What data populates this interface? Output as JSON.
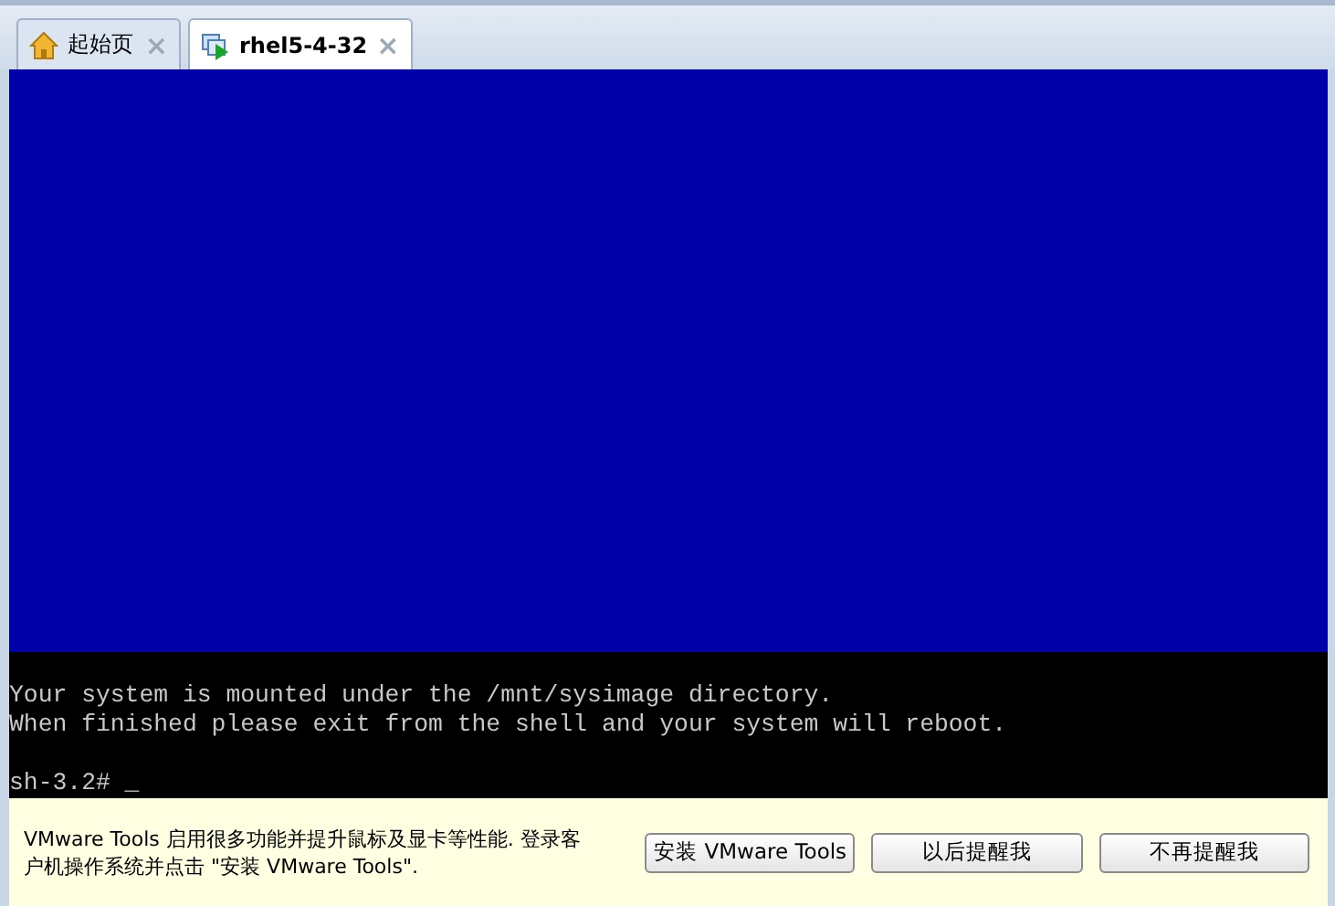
{
  "tabs": [
    {
      "label": "起始页",
      "kind": "home",
      "selected": false,
      "close": "×"
    },
    {
      "label": "rhel5-4-32",
      "kind": "vm",
      "selected": true,
      "close": "×"
    }
  ],
  "console": {
    "messages": [
      "Your system is mounted under the /mnt/sysimage directory.",
      "When finished please exit from the shell and your system will reboot."
    ],
    "prompt": "sh-3.2# _"
  },
  "notification": {
    "message": "VMware Tools 启用很多功能并提升鼠标及显卡等性能. 登录客户机操作系统并点击 \"安装 VMware Tools\".",
    "buttons": [
      "安装 VMware Tools",
      "以后提醒我",
      "不再提醒我"
    ]
  }
}
